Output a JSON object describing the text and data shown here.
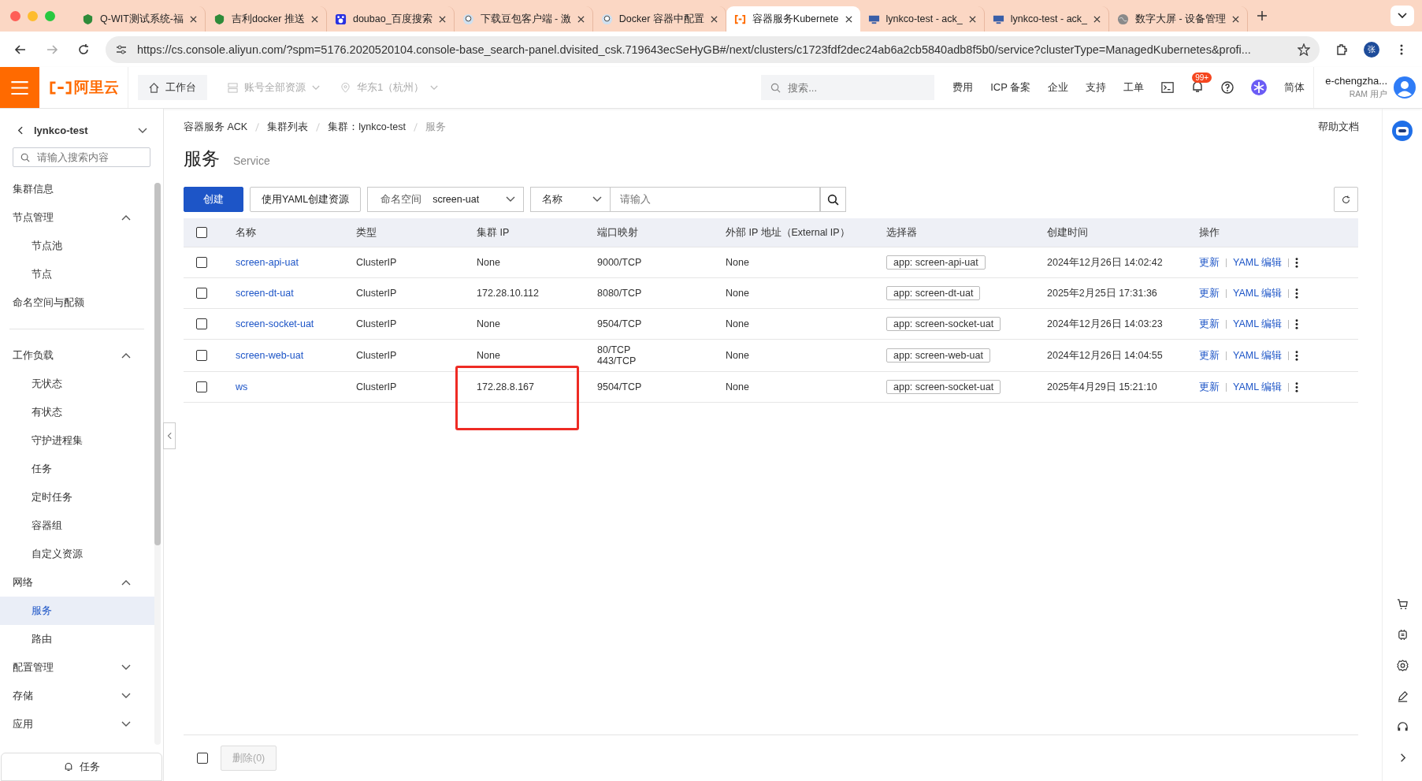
{
  "browser": {
    "tabs": [
      {
        "title": "Q-WIT测试系统-福",
        "kind": "shield",
        "selected": false
      },
      {
        "title": "吉利docker 推送",
        "kind": "shield",
        "selected": false
      },
      {
        "title": "doubao_百度搜索",
        "kind": "paw",
        "selected": false
      },
      {
        "title": "下载豆包客户端 - 激",
        "kind": "avatar",
        "selected": false
      },
      {
        "title": "Docker 容器中配置",
        "kind": "avatar",
        "selected": false
      },
      {
        "title": "容器服务Kubernete",
        "kind": "aliyun",
        "selected": true
      },
      {
        "title": "lynkco-test - ack_",
        "kind": "monitor",
        "selected": false
      },
      {
        "title": "lynkco-test - ack_",
        "kind": "monitor",
        "selected": false
      },
      {
        "title": "数字大屏 - 设备管理",
        "kind": "globe",
        "selected": false
      }
    ],
    "url": "https://cs.console.aliyun.com/?spm=5176.2020520104.console-base_search-panel.dvisited_csk.719643ecSeHyGB#/next/clusters/c1723fdf2dec24ab6a2cb5840adb8f5b0/service?clusterType=ManagedKubernetes&profi...",
    "profile_initial": "张"
  },
  "topbar": {
    "logo": "阿里云",
    "workbench": "工作台",
    "account": "账号全部资源",
    "region": "华东1（杭州）",
    "search_placeholder": "搜索...",
    "links": [
      "费用",
      "ICP 备案",
      "企业",
      "支持",
      "工单"
    ],
    "notification_badge": "99+",
    "language": "简体",
    "user": "e-chengzha...",
    "user_role": "RAM 用户"
  },
  "sidebar": {
    "cluster": "lynkco-test",
    "search_placeholder": "请输入搜索内容",
    "groups": [
      [
        {
          "label": "集群信息"
        },
        {
          "label": "节点管理",
          "expanded": true,
          "children": [
            {
              "label": "节点池",
              "selected": false
            },
            {
              "label": "节点",
              "selected": false
            }
          ]
        },
        {
          "label": "命名空间与配额"
        }
      ],
      [
        {
          "label": "工作负载",
          "expanded": true,
          "children": [
            {
              "label": "无状态",
              "selected": false
            },
            {
              "label": "有状态",
              "selected": false
            },
            {
              "label": "守护进程集",
              "selected": false
            },
            {
              "label": "任务",
              "selected": false
            },
            {
              "label": "定时任务",
              "selected": false
            },
            {
              "label": "容器组",
              "selected": false
            },
            {
              "label": "自定义资源",
              "selected": false
            }
          ]
        },
        {
          "label": "网络",
          "expanded": true,
          "children": [
            {
              "label": "服务",
              "selected": true
            },
            {
              "label": "路由",
              "selected": false
            }
          ]
        },
        {
          "label": "配置管理",
          "expanded": false
        },
        {
          "label": "存储",
          "expanded": false
        },
        {
          "label": "应用",
          "expanded": false
        }
      ]
    ],
    "tasks": "任务"
  },
  "breadcrumb": [
    "容器服务 ACK",
    "集群列表",
    "集群：lynkco-test",
    "服务"
  ],
  "help": "帮助文档",
  "title": "服务",
  "subtitle": "Service",
  "toolbar": {
    "create": "创建",
    "yaml_create": "使用YAML创建资源",
    "namespace_label": "命名空间",
    "namespace": "screen-uat",
    "filter_field": "名称",
    "filter_placeholder": "请输入"
  },
  "table": {
    "select_all_checked": false,
    "columns": [
      "名称",
      "类型",
      "集群 IP",
      "端口映射",
      "外部 IP 地址（External IP）",
      "选择器",
      "创建时间",
      "操作"
    ],
    "rows": [
      {
        "name": "screen-api-uat",
        "type": "ClusterIP",
        "cluster_ip": "None",
        "ports": [
          "9000/TCP"
        ],
        "external_ip": "None",
        "selector": "app: screen-api-uat",
        "created": "2024年12月26日 14:02:42",
        "actions": [
          "更新",
          "YAML 编辑"
        ],
        "checked": false,
        "highlighted": false
      },
      {
        "name": "screen-dt-uat",
        "type": "ClusterIP",
        "cluster_ip": "172.28.10.112",
        "ports": [
          "8080/TCP"
        ],
        "external_ip": "None",
        "selector": "app: screen-dt-uat",
        "created": "2025年2月25日 17:31:36",
        "actions": [
          "更新",
          "YAML 编辑"
        ],
        "checked": false,
        "highlighted": false
      },
      {
        "name": "screen-socket-uat",
        "type": "ClusterIP",
        "cluster_ip": "None",
        "ports": [
          "9504/TCP"
        ],
        "external_ip": "None",
        "selector": "app: screen-socket-uat",
        "created": "2024年12月26日 14:03:23",
        "actions": [
          "更新",
          "YAML 编辑"
        ],
        "checked": false,
        "highlighted": false
      },
      {
        "name": "screen-web-uat",
        "type": "ClusterIP",
        "cluster_ip": "None",
        "ports": [
          "80/TCP",
          "443/TCP"
        ],
        "external_ip": "None",
        "selector": "app: screen-web-uat",
        "created": "2024年12月26日 14:04:55",
        "actions": [
          "更新",
          "YAML 编辑"
        ],
        "checked": false,
        "highlighted": false
      },
      {
        "name": "ws",
        "type": "ClusterIP",
        "cluster_ip": "172.28.8.167",
        "ports": [
          "9504/TCP"
        ],
        "external_ip": "None",
        "selector": "app: screen-socket-uat",
        "created": "2025年4月29日 15:21:10",
        "actions": [
          "更新",
          "YAML 编辑"
        ],
        "checked": false,
        "highlighted": true
      }
    ]
  },
  "footer": {
    "checked": false,
    "delete": "删除(0)"
  }
}
